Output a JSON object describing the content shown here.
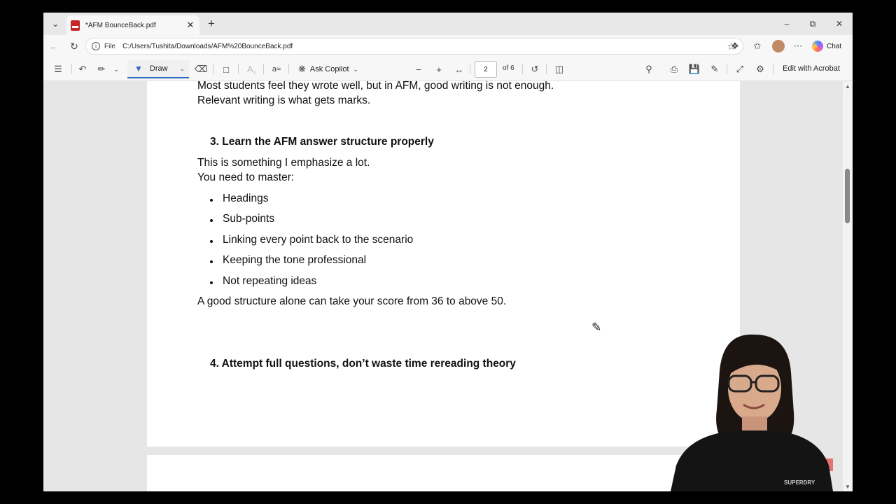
{
  "browser": {
    "tab": {
      "title": "*AFM BounceBack.pdf"
    },
    "address": {
      "scheme_label": "File",
      "url": "C:/Users/Tushita/Downloads/AFM%20BounceBack.pdf"
    },
    "chat_label": "Chat"
  },
  "pdf_toolbar": {
    "draw_label": "Draw",
    "ask_copilot_label": "Ask Copilot",
    "page_current": "2",
    "page_total_label": "of 6",
    "edit_acrobat_label": "Edit with Acrobat"
  },
  "document": {
    "intro_line1": "Most students feel they wrote well, but in AFM, good writing is not enough.",
    "intro_line2": "Relevant writing is what gets marks.",
    "section3_heading": "3. Learn the AFM answer structure properly",
    "section3_line1": "This is something I emphasize a lot.",
    "section3_line2": "You need to master:",
    "bullets": [
      "Headings",
      "Sub-points",
      "Linking every point back to the scenario",
      "Keeping the tone professional",
      "Not repeating ideas"
    ],
    "section3_closing": "A good structure alone can take your score from 36 to above 50.",
    "section4_heading": "4. Attempt full questions, don’t waste time rereading theory"
  },
  "icons": {
    "pdf_file": "pdf-icon",
    "pen_cursor": "pen-icon"
  },
  "colors": {
    "accent": "#2b66c7",
    "pdf_icon": "#c62828"
  }
}
